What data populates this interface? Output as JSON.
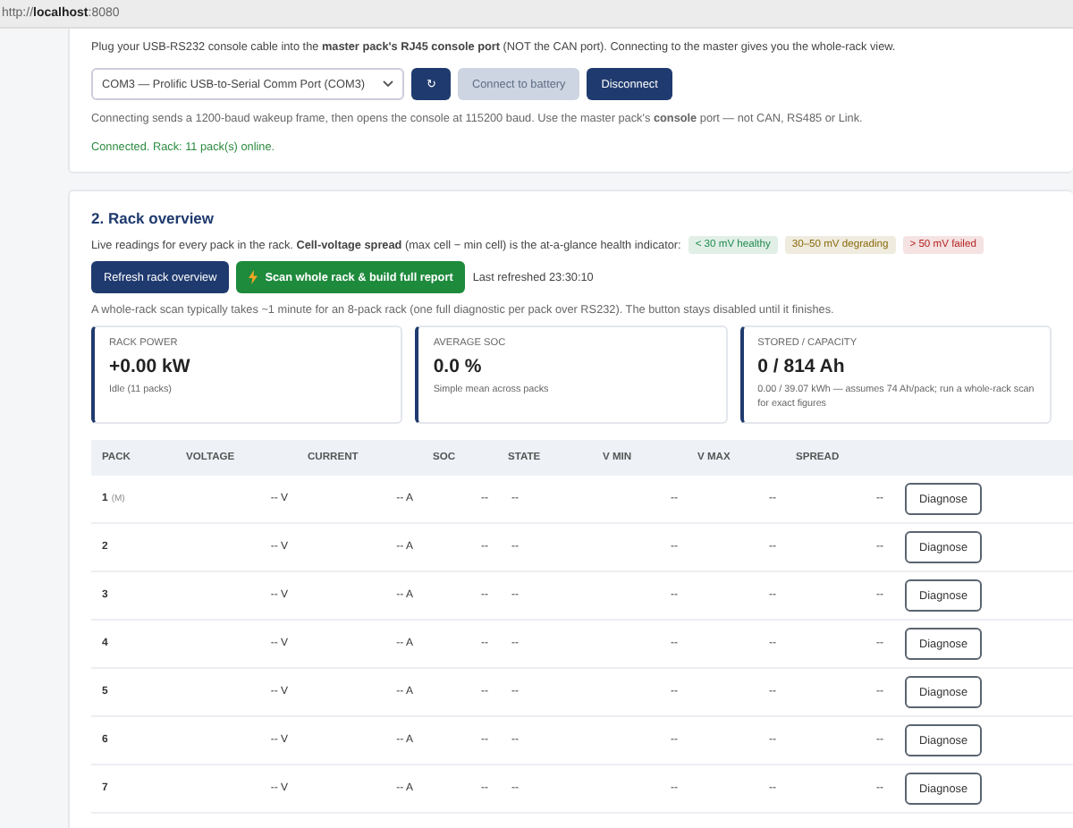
{
  "address_bar": {
    "url": "http://**localhost**:8080"
  },
  "connection": {
    "intro": "Plug your USB-RS232 console cable into the **master pack's RJ45 console port** (NOT the CAN port). Connecting to the master gives you the whole-rack view.",
    "port_select": {
      "value": "COM3 — Prolific USB-to-Serial Comm Port (COM3)"
    },
    "buttons": [
      {
        "label": "↻",
        "kind": "primary",
        "disabled": false
      },
      {
        "label": "Connect to battery",
        "kind": "primary",
        "disabled": true
      },
      {
        "label": "Disconnect",
        "kind": "primary",
        "disabled": false
      }
    ],
    "hint": "Connecting sends a 1200-baud wakeup frame, then opens the console at 115200 baud. Use the master pack's **console** port — not CAN, RS485 or Link.",
    "status": "Connected. Rack: 11 pack(s) online."
  },
  "rack_overview": {
    "title": "2. Rack overview",
    "description": "Live readings for every pack in the rack. **Cell-voltage spread** (max cell − min cell) is the at-a-glance health indicator:",
    "legend": [
      {
        "label": "< 30 mV healthy",
        "color": "#1f8a4c"
      },
      {
        "label": "30–50 mV degrading",
        "color": "#8a6a0c"
      },
      {
        "label": "> 50 mV failed",
        "color": "#b42323"
      }
    ],
    "buttons": [
      {
        "label": "Refresh rack overview",
        "kind": "primary"
      },
      {
        "label": "Scan whole rack & build full report",
        "kind": "success"
      }
    ],
    "last_refreshed": "Last refreshed 23:30:10",
    "note": "A whole-rack scan typically takes ~1 minute for an 8-pack rack (one full diagnostic per pack over RS232). The button stays disabled until it finishes.",
    "metrics": [
      {
        "label": "RACK POWER",
        "value": "+0.00 kW",
        "detail": "Idle (11 packs)"
      },
      {
        "label": "AVERAGE SOC",
        "value": "0.0 %",
        "detail": "Simple mean across packs"
      },
      {
        "label": "STORED / CAPACITY",
        "value": "0 / 814 Ah",
        "detail": "0.00 / 39.07 kWh — assumes 74 Ah/pack; run a whole-rack scan for exact figures"
      }
    ],
    "table": {
      "columns": [
        "PACK",
        "VOLTAGE",
        "CURRENT",
        "SOC",
        "STATE",
        "V MIN",
        "V MAX",
        "SPREAD"
      ],
      "rows": [
        {
          "pack": "1",
          "tag": "(M)",
          "voltage": "-- V",
          "current": "-- A",
          "soc": "--",
          "state": "--",
          "v_min": "--",
          "v_max": "--",
          "spread": "--",
          "action": "Diagnose"
        },
        {
          "pack": "2",
          "voltage": "-- V",
          "current": "-- A",
          "soc": "--",
          "state": "--",
          "v_min": "--",
          "v_max": "--",
          "spread": "--",
          "action": "Diagnose"
        },
        {
          "pack": "3",
          "voltage": "-- V",
          "current": "-- A",
          "soc": "--",
          "state": "--",
          "v_min": "--",
          "v_max": "--",
          "spread": "--",
          "action": "Diagnose"
        },
        {
          "pack": "4",
          "voltage": "-- V",
          "current": "-- A",
          "soc": "--",
          "state": "--",
          "v_min": "--",
          "v_max": "--",
          "spread": "--",
          "action": "Diagnose"
        },
        {
          "pack": "5",
          "voltage": "-- V",
          "current": "-- A",
          "soc": "--",
          "state": "--",
          "v_min": "--",
          "v_max": "--",
          "spread": "--",
          "action": "Diagnose"
        },
        {
          "pack": "6",
          "voltage": "-- V",
          "current": "-- A",
          "soc": "--",
          "state": "--",
          "v_min": "--",
          "v_max": "--",
          "spread": "--",
          "action": "Diagnose"
        },
        {
          "pack": "7",
          "voltage": "-- V",
          "current": "-- A",
          "soc": "--",
          "state": "--",
          "v_min": "--",
          "v_max": "--",
          "spread": "--",
          "action": "Diagnose"
        }
      ]
    }
  }
}
